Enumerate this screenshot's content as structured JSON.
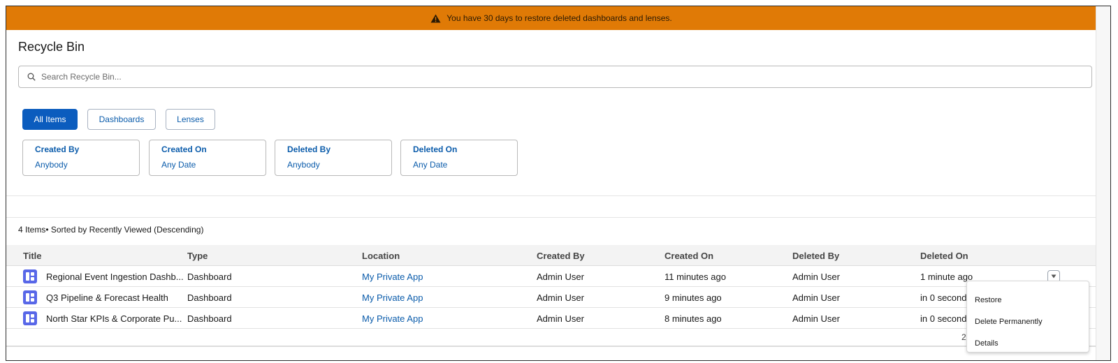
{
  "banner": {
    "text": "You have 30 days to restore deleted dashboards and lenses.",
    "icon": "warning-icon",
    "color": "#e07a06"
  },
  "page": {
    "title": "Recycle Bin"
  },
  "search": {
    "placeholder": "Search Recycle Bin..."
  },
  "tabs": [
    {
      "label": "All Items",
      "active": true
    },
    {
      "label": "Dashboards",
      "active": false
    },
    {
      "label": "Lenses",
      "active": false
    }
  ],
  "filters": [
    {
      "label": "Created By",
      "value": "Anybody"
    },
    {
      "label": "Created On",
      "value": "Any Date"
    },
    {
      "label": "Deleted By",
      "value": "Anybody"
    },
    {
      "label": "Deleted On",
      "value": "Any Date"
    }
  ],
  "list": {
    "summary": "4 Items• Sorted by Recently Viewed (Descending)",
    "columns": [
      "Title",
      "Type",
      "Location",
      "Created By",
      "Created On",
      "Deleted By",
      "Deleted On"
    ],
    "rows": [
      {
        "title": "Regional Event Ingestion Dashb...",
        "type": "Dashboard",
        "location": "My Private App",
        "created_by": "Admin User",
        "created_on": "11 minutes ago",
        "deleted_by": "Admin User",
        "deleted_on": "1 minute ago",
        "icon": "dashboard-icon"
      },
      {
        "title": "Q3 Pipeline & Forecast Health",
        "type": "Dashboard",
        "location": "My Private App",
        "created_by": "Admin User",
        "created_on": "9 minutes ago",
        "deleted_by": "Admin User",
        "deleted_on": "in 0 seconds",
        "icon": "dashboard-icon"
      },
      {
        "title": "North Star KPIs & Corporate Pu...",
        "type": "Dashboard",
        "location": "My Private App",
        "created_by": "Admin User",
        "created_on": "8 minutes ago",
        "deleted_by": "Admin User",
        "deleted_on": "in 0 seconds",
        "icon": "dashboard-icon"
      }
    ],
    "footer_mark": "2"
  },
  "row_menu": {
    "items": [
      "Restore",
      "Delete Permanently",
      "Details"
    ]
  },
  "colors": {
    "accent": "#0b5cbe",
    "link": "#0b5cab",
    "banner": "#e07a06",
    "dashboard_icon": "#5867e8"
  }
}
